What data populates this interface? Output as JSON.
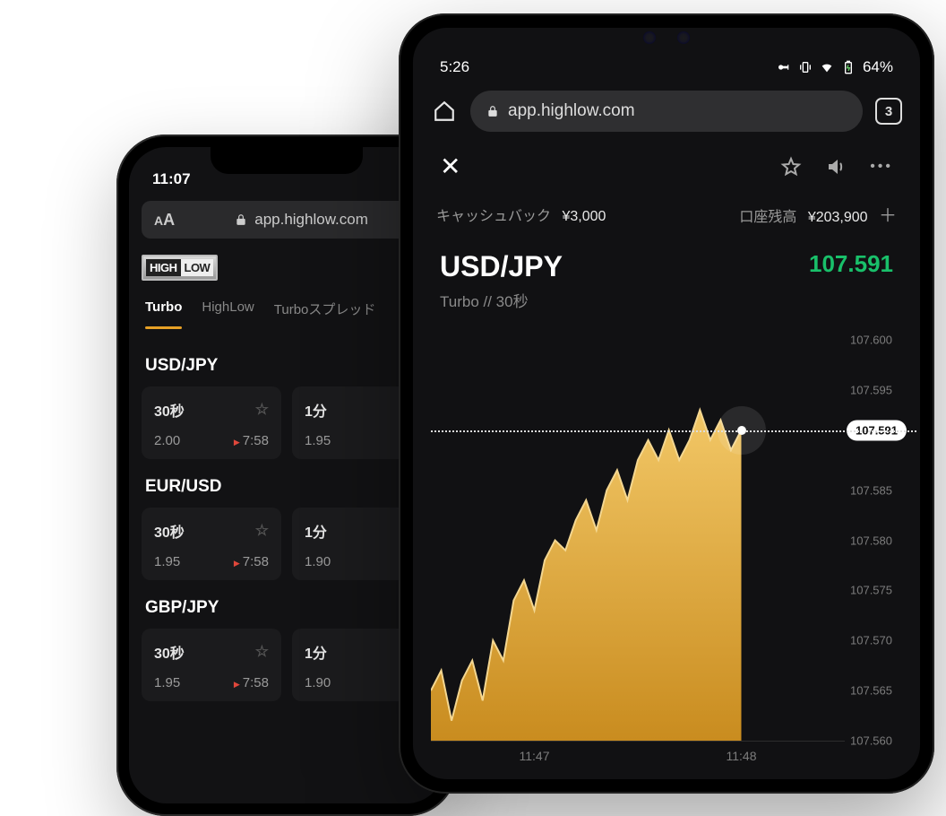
{
  "back_phone": {
    "status_time": "11:07",
    "url_display": "app.highlow.com",
    "logo": {
      "high": "HIGH",
      "low": "LOW"
    },
    "tabs": [
      "Turbo",
      "HighLow",
      "Turboスプレッド"
    ],
    "active_tab": 0,
    "pairs": [
      {
        "symbol": "USD/JPY",
        "cards": [
          {
            "duration": "30秒",
            "payout": "2.00",
            "countdown": "7:58",
            "star": true
          },
          {
            "duration": "1分",
            "payout": "1.95"
          }
        ]
      },
      {
        "symbol": "EUR/USD",
        "cards": [
          {
            "duration": "30秒",
            "payout": "1.95",
            "countdown": "7:58",
            "star": true
          },
          {
            "duration": "1分",
            "payout": "1.90"
          }
        ]
      },
      {
        "symbol": "GBP/JPY",
        "cards": [
          {
            "duration": "30秒",
            "payout": "1.95",
            "countdown": "7:58",
            "star": true
          },
          {
            "duration": "1分",
            "payout": "1.90"
          }
        ]
      }
    ]
  },
  "front_phone": {
    "status_time": "5:26",
    "battery_pct": "64%",
    "url_display": "app.highlow.com",
    "tab_count": "3",
    "balance": {
      "cashback_label": "キャッシュバック",
      "cashback_value": "¥3,000",
      "balance_label": "口座残高",
      "balance_value": "¥203,900"
    },
    "pair": {
      "symbol": "USD/JPY",
      "subtitle": "Turbo  //  30秒",
      "price": "107.591"
    }
  },
  "chart_data": {
    "type": "area",
    "title": "USD/JPY",
    "xlabel": "",
    "ylabel": "",
    "ylim": [
      107.56,
      107.6
    ],
    "x_ticks": [
      "11:47",
      "11:48"
    ],
    "y_ticks": [
      107.56,
      107.565,
      107.57,
      107.575,
      107.58,
      107.585,
      107.591,
      107.595,
      107.6
    ],
    "current_price": 107.591,
    "series": [
      {
        "name": "USD/JPY",
        "color": "#e6b24a",
        "x": [
          0,
          1,
          2,
          3,
          4,
          5,
          6,
          7,
          8,
          9,
          10,
          11,
          12,
          13,
          14,
          15,
          16,
          17,
          18,
          19,
          20,
          21,
          22,
          23,
          24,
          25,
          26,
          27,
          28,
          29,
          30
        ],
        "values": [
          107.565,
          107.567,
          107.562,
          107.566,
          107.568,
          107.564,
          107.57,
          107.568,
          107.574,
          107.576,
          107.573,
          107.578,
          107.58,
          107.579,
          107.582,
          107.584,
          107.581,
          107.585,
          107.587,
          107.584,
          107.588,
          107.59,
          107.588,
          107.591,
          107.588,
          107.59,
          107.593,
          107.59,
          107.592,
          107.589,
          107.591
        ]
      }
    ]
  }
}
